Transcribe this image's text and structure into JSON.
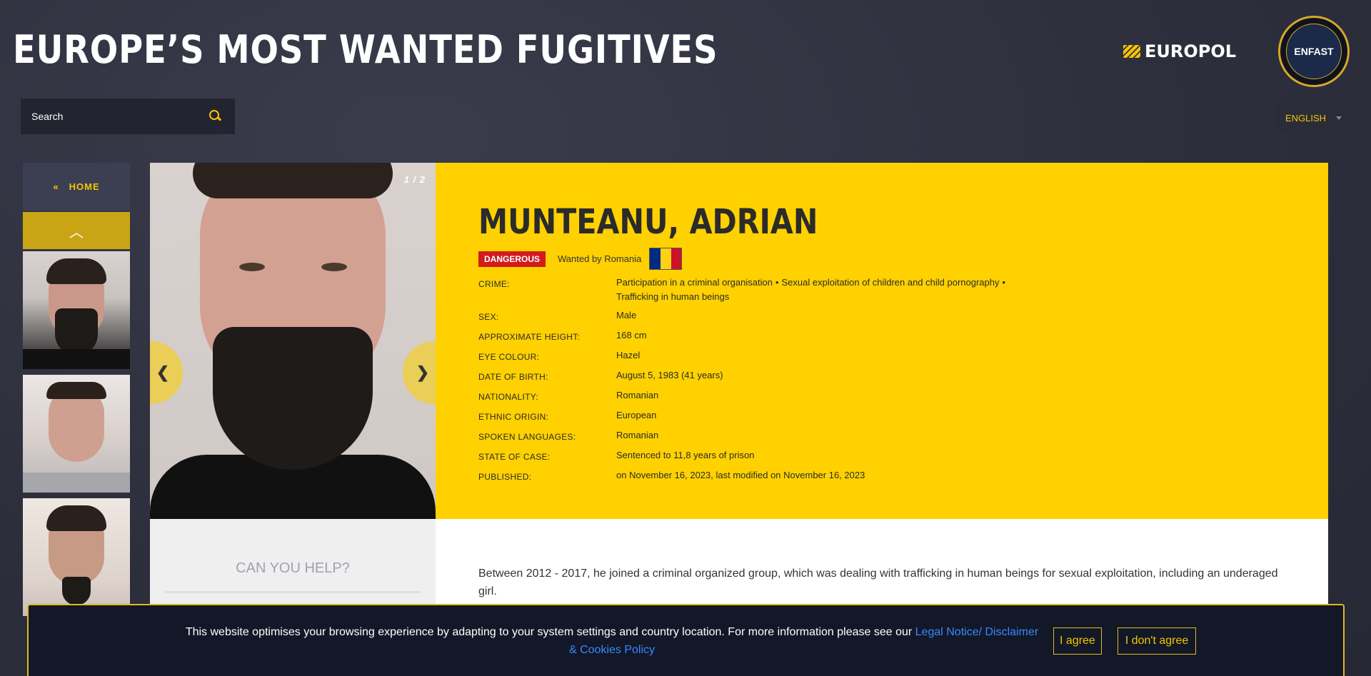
{
  "header": {
    "title": "EUROPE’S MOST WANTED FUGITIVES",
    "europol_logo": "EUROPOL",
    "enfast_logo": "ENFAST"
  },
  "search": {
    "placeholder": "Search"
  },
  "language": {
    "selected": "ENGLISH"
  },
  "sidebar": {
    "home_label": "HOME",
    "home_icon": "double-chevron-left-icon",
    "up_icon": "chevron-up-icon",
    "thumbnails": [
      "fugitive-thumbnail-1",
      "fugitive-thumbnail-2",
      "fugitive-thumbnail-3"
    ]
  },
  "photo": {
    "counter": "1 / 2",
    "prev_icon": "chevron-left-icon",
    "next_icon": "chevron-right-icon"
  },
  "profile": {
    "name": "MUNTEANU, ADRIAN",
    "badge": "DANGEROUS",
    "wanted_by": "Wanted by Romania",
    "flag_colors": [
      "#002B7F",
      "#FCD116",
      "#CE1126"
    ],
    "crime_label": "CRIME:",
    "crimes": [
      "Participation in a criminal organisation",
      "Sexual exploitation of children and child pornography",
      "Trafficking in human beings"
    ],
    "fields": [
      {
        "label": "SEX:",
        "value": "Male"
      },
      {
        "label": "APPROXIMATE HEIGHT:",
        "value": "168 cm"
      },
      {
        "label": "EYE COLOUR:",
        "value": "Hazel"
      },
      {
        "label": "DATE OF BIRTH:",
        "value": "August 5, 1983 (41 years)"
      },
      {
        "label": "NATIONALITY:",
        "value": "Romanian"
      },
      {
        "label": "ETHNIC ORIGIN:",
        "value": "European"
      },
      {
        "label": "SPOKEN LANGUAGES:",
        "value": "Romanian"
      },
      {
        "label": "STATE OF CASE:",
        "value": "Sentenced to 11,8 years of prison"
      },
      {
        "label": "PUBLISHED:",
        "value": "on November 16, 2023, last modified on November 16, 2023"
      }
    ]
  },
  "help": {
    "heading": "CAN YOU HELP?"
  },
  "description": "Between 2012 - 2017, he joined a criminal organized group, which was dealing with trafficking in human beings for sexual exploitation, including an underaged girl.",
  "cookie": {
    "message": "This website optimises your browsing experience by adapting to your system settings and country location. For more information please see our",
    "link": "Legal Notice/ Disclaimer & Cookies Policy",
    "agree": "I agree",
    "disagree": "I don't agree"
  },
  "colors": {
    "accent_yellow": "#FFD100",
    "danger_red": "#D21B1B",
    "link_blue": "#3A86FF",
    "background": "#2F3140"
  }
}
